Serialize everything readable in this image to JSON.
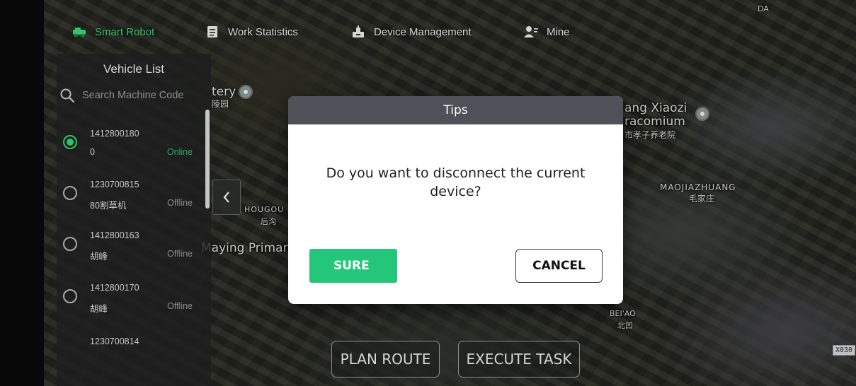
{
  "nav": {
    "items": [
      {
        "label": "Smart Robot",
        "icon": "robot-icon",
        "active": true
      },
      {
        "label": "Work Statistics",
        "icon": "clipboard-icon",
        "active": false
      },
      {
        "label": "Device Management",
        "icon": "device-management-icon",
        "active": false
      },
      {
        "label": "Mine",
        "icon": "user-icon",
        "active": false
      }
    ]
  },
  "sidebar": {
    "title": "Vehicle List",
    "search": {
      "placeholder": "Search Machine Code",
      "value": ""
    },
    "vehicles": [
      {
        "code": "1412800180",
        "name": "0",
        "status": "Online",
        "selected": true
      },
      {
        "code": "1230700815",
        "name": "80割草机",
        "status": "Offline",
        "selected": false
      },
      {
        "code": "1412800163",
        "name": "胡峰",
        "status": "Offline",
        "selected": false
      },
      {
        "code": "1412800170",
        "name": "胡峰",
        "status": "Offline",
        "selected": false
      },
      {
        "code": "1230700814",
        "name": "",
        "status": "",
        "selected": false
      }
    ]
  },
  "map": {
    "labels": {
      "tery": "tery",
      "tery_cn": "陵园",
      "hougou": "HOUGOU",
      "hougou_cn": "后沟",
      "maying": "Maying Primar",
      "xiaozi": "ang Xiaozi",
      "xiaozi2": "racomium",
      "xiaozi_cn": "市孝子养老院",
      "maojiazhuang": "MAOJIAZHUANG",
      "maojiazhuang_cn": "毛家庄",
      "beiao": "BEI'AO",
      "beiao_cn": "北凹",
      "road": "X030",
      "da": "DA"
    }
  },
  "map_buttons": {
    "plan_route": "PLAN ROUTE",
    "execute_task": "EXECUTE TASK"
  },
  "dialog": {
    "title": "Tips",
    "message": "Do you want to disconnect the current device?",
    "sure_label": "SURE",
    "cancel_label": "CANCEL"
  },
  "colors": {
    "accent_green": "#31c56c",
    "sure_button": "#24c77a",
    "dialog_header": "#505158"
  }
}
